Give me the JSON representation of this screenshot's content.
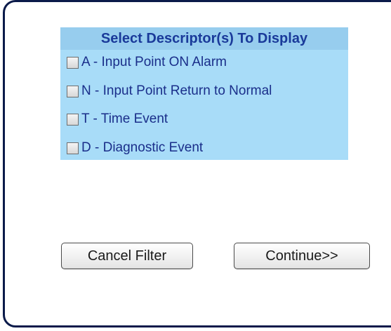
{
  "filter_panel": {
    "title": "Select Descriptor(s) To Display",
    "options": [
      {
        "label": "A - Input Point ON Alarm",
        "checked": false
      },
      {
        "label": "N - Input Point Return to Normal",
        "checked": false
      },
      {
        "label": "T - Time Event",
        "checked": false
      },
      {
        "label": "D - Diagnostic Event",
        "checked": false
      }
    ]
  },
  "buttons": {
    "cancel_label": "Cancel Filter",
    "continue_label": "Continue>>"
  },
  "colors": {
    "panel_background": "#a8dcf8",
    "header_background": "#97cdee",
    "text_color": "#1a2e8a",
    "frame_border": "#0a1a4a"
  }
}
